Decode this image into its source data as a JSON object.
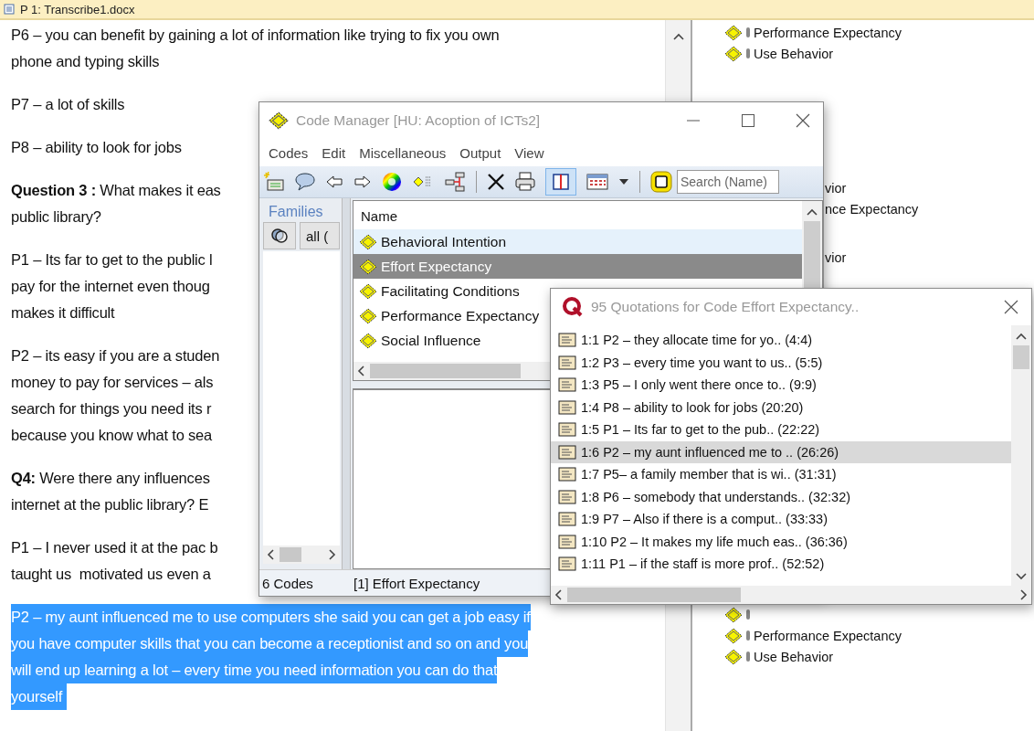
{
  "document": {
    "title": "P 1: Transcribe1.docx",
    "paragraphs": [
      {
        "highlighted": false,
        "lines": [
          "P6 – you can benefit by gaining a lot of information like trying to fix you own",
          "phone and typing skills"
        ],
        "margin_codes": [
          {
            "kind": "full",
            "label": "Performance Expectancy"
          },
          {
            "kind": "full",
            "label": "Use Behavior"
          }
        ]
      },
      {
        "highlighted": false,
        "lines": [
          "P7 – a lot of skills"
        ]
      },
      {
        "highlighted": false,
        "lines": [
          "P8 – ability to look for jobs"
        ]
      },
      {
        "highlighted": false,
        "lines": [
          "**Question 3 :** What makes it eas",
          "public library?"
        ],
        "margin_codes": [
          {
            "kind": "cut",
            "label": "vior"
          },
          {
            "kind": "cut",
            "label": "nce Expectancy"
          }
        ]
      },
      {
        "highlighted": false,
        "lines": [
          "P1 – Its far to get to the public l",
          "pay for the internet even thoug",
          "makes it difficult"
        ],
        "margin_codes": [
          {
            "kind": "cut",
            "label": "vior"
          }
        ]
      },
      {
        "highlighted": false,
        "lines": [
          "P2 – its easy if you are a studen",
          "money to pay for services – als",
          "search for things you need its r",
          "because you know what to sea"
        ]
      },
      {
        "highlighted": false,
        "lines": [
          "**Q4:** Were there any influences",
          "internet at the public library? E"
        ]
      },
      {
        "highlighted": false,
        "lines": [
          "P1 – I never used it at the pac b",
          "taught us  motivated us even a"
        ]
      },
      {
        "highlighted": true,
        "lines": [
          "P2 – my aunt influenced me to use computers she said you can get a job easy if",
          "you have computer skills that you can become a receptionist and so on and you",
          "will end up learning a lot – every time you need information you can do that",
          "yourself "
        ],
        "margin_codes": [
          {
            "kind": "blank"
          },
          {
            "kind": "full",
            "label": "Performance Expectancy"
          },
          {
            "kind": "full",
            "label": "Use Behavior"
          }
        ]
      }
    ]
  },
  "code_manager": {
    "title": "Code Manager [HU: Acoption of ICTs2]",
    "menu": [
      "Codes",
      "Edit",
      "Miscellaneous",
      "Output",
      "View"
    ],
    "toolbar": {
      "split_view_on": true
    },
    "search": {
      "placeholder": "Search (Name)"
    },
    "families": {
      "label": "Families",
      "filter_button": "all ("
    },
    "column_header": "Name",
    "codes": [
      {
        "label": "Behavioral Intention",
        "selected": false,
        "hovered": true
      },
      {
        "label": "Effort Expectancy",
        "selected": true,
        "hovered": false
      },
      {
        "label": "Facilitating Conditions",
        "selected": false,
        "hovered": false
      },
      {
        "label": "Performance Expectancy",
        "selected": false,
        "hovered": false
      },
      {
        "label": "Social Influence",
        "selected": false,
        "hovered": false
      }
    ],
    "status": [
      "6 Codes",
      "[1] Effort Expectancy"
    ]
  },
  "quotations": {
    "title": "95 Quotations for Code Effort Expectancy..",
    "items": [
      {
        "text": "1:1 P2 – they allocate time for yo.. (4:4)",
        "selected": false
      },
      {
        "text": "1:2 P3 – every time you want to us.. (5:5)",
        "selected": false
      },
      {
        "text": "1:3 P5 – I only went there once to.. (9:9)",
        "selected": false
      },
      {
        "text": "1:4 P8 – ability to look for jobs (20:20)",
        "selected": false
      },
      {
        "text": "1:5 P1 – Its far to get to the pub.. (22:22)",
        "selected": false
      },
      {
        "text": "1:6 P2 – my aunt influenced me to .. (26:26)",
        "selected": true
      },
      {
        "text": "1:7 P5– a family member that is wi.. (31:31)",
        "selected": false
      },
      {
        "text": "1:8 P6 – somebody that understands.. (32:32)",
        "selected": false
      },
      {
        "text": "1:9 P7 – Also if there is a comput.. (33:33)",
        "selected": false
      },
      {
        "text": "1:10 P2 – It makes my life much eas.. (36:36)",
        "selected": false
      },
      {
        "text": "1:11 P1 – if the staff is more prof.. (52:52)",
        "selected": false
      }
    ]
  }
}
